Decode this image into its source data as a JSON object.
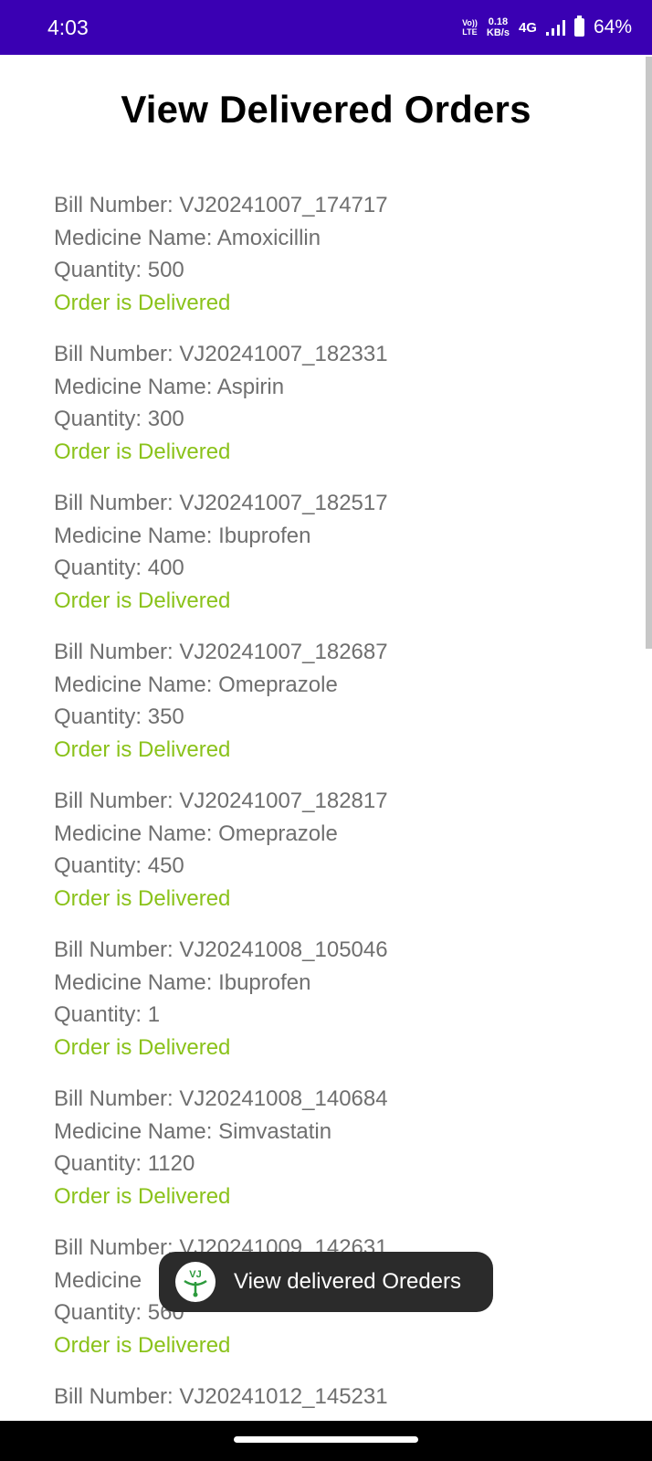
{
  "status_bar": {
    "time": "4:03",
    "volte_top": "Vo))",
    "volte_bottom": "LTE",
    "speed_value": "0.18",
    "speed_unit": "KB/s",
    "network": "4G",
    "battery": "64%",
    "background_color": "#3a00b3"
  },
  "page": {
    "title": "View Delivered Orders"
  },
  "orders": [
    {
      "bill": "Bill Number: VJ20241007_174717",
      "medicine": "Medicine Name: Amoxicillin",
      "quantity": "Quantity: 500",
      "status": "Order is Delivered"
    },
    {
      "bill": "Bill Number: VJ20241007_182331",
      "medicine": "Medicine Name: Aspirin",
      "quantity": "Quantity: 300",
      "status": "Order is Delivered"
    },
    {
      "bill": "Bill Number: VJ20241007_182517",
      "medicine": "Medicine Name: Ibuprofen",
      "quantity": "Quantity: 400",
      "status": "Order is Delivered"
    },
    {
      "bill": "Bill Number: VJ20241007_182687",
      "medicine": "Medicine Name: Omeprazole",
      "quantity": "Quantity: 350",
      "status": "Order is Delivered"
    },
    {
      "bill": "Bill Number: VJ20241007_182817",
      "medicine": "Medicine Name: Omeprazole",
      "quantity": "Quantity: 450",
      "status": "Order is Delivered"
    },
    {
      "bill": "Bill Number: VJ20241008_105046",
      "medicine": "Medicine Name: Ibuprofen",
      "quantity": "Quantity: 1",
      "status": "Order is Delivered"
    },
    {
      "bill": "Bill Number: VJ20241008_140684",
      "medicine": "Medicine Name: Simvastatin",
      "quantity": "Quantity: 1120",
      "status": "Order is Delivered"
    },
    {
      "bill": "Bill Number: VJ20241009_142631",
      "medicine": "Medicine",
      "quantity": "Quantity: 560",
      "status": "Order is Delivered"
    },
    {
      "bill": "Bill Number: VJ20241012_145231",
      "medicine": "",
      "quantity": "",
      "status": ""
    }
  ],
  "toast": {
    "icon_text": "VJ",
    "icon": "app-logo-icon",
    "text": "View delivered Oreders"
  },
  "colors": {
    "delivered_status": "#8ac21a",
    "body_text": "#6f6f6f",
    "toast_background": "#2b2b2b"
  }
}
